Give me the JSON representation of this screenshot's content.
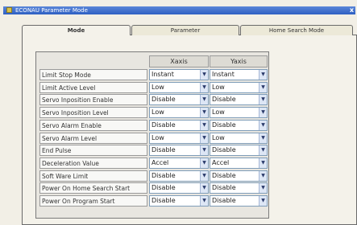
{
  "window": {
    "title": "ECONAU Parameter Mode",
    "close": "x"
  },
  "tabs": [
    {
      "label": "Mode"
    },
    {
      "label": "Parameter"
    },
    {
      "label": "Home Search Mode"
    }
  ],
  "grid": {
    "columns": [
      "Xaxis",
      "Yaxis"
    ],
    "dropdown_icon": "chevron-down-icon",
    "rows": [
      {
        "label": "Limit Stop Mode",
        "x": "Instant",
        "y": "Instant"
      },
      {
        "label": "Limit Active Level",
        "x": "Low",
        "y": "Low"
      },
      {
        "label": "Servo Inposition Enable",
        "x": "Disable",
        "y": "Disable"
      },
      {
        "label": "Servo Inposition Level",
        "x": "Low",
        "y": "Low"
      },
      {
        "label": "Servo Alarm Enable",
        "x": "Disable",
        "y": "Disable"
      },
      {
        "label": "Servo Alarm Level",
        "x": "Low",
        "y": "Low"
      },
      {
        "label": "End Pulse",
        "x": "Disable",
        "y": "Disable"
      },
      {
        "label": "Deceleration Value",
        "x": "Accel",
        "y": "Accel"
      },
      {
        "label": "Soft Ware Limit",
        "x": "Disable",
        "y": "Disable"
      },
      {
        "label": "Power On Home Search Start",
        "x": "Disable",
        "y": "Disable"
      },
      {
        "label": "Power On Program Start",
        "x": "Disable",
        "y": "Disable"
      }
    ]
  }
}
